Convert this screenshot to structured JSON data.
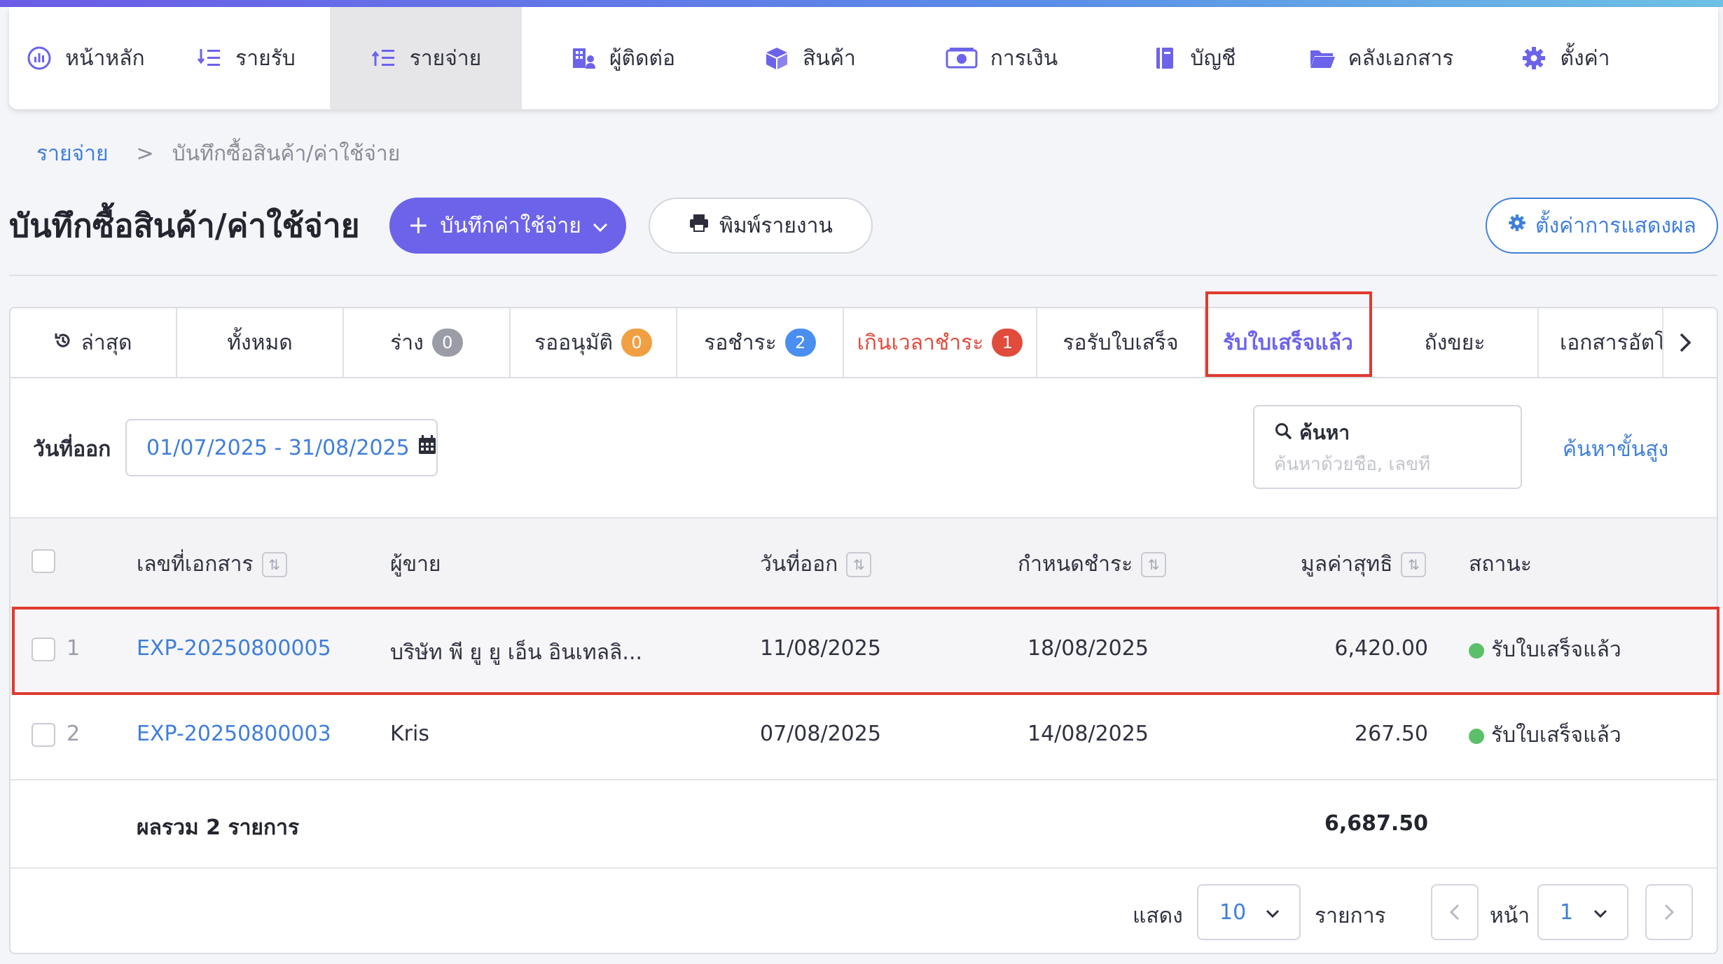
{
  "nav": {
    "items": [
      {
        "label": "หน้าหลัก",
        "icon": "dashboard-icon"
      },
      {
        "label": "รายรับ",
        "icon": "income-list-icon"
      },
      {
        "label": "รายจ่าย",
        "icon": "expense-list-icon",
        "active": true
      },
      {
        "label": "ผู้ติดต่อ",
        "icon": "contacts-building-icon"
      },
      {
        "label": "สินค้า",
        "icon": "product-box-icon"
      },
      {
        "label": "การเงิน",
        "icon": "money-icon"
      },
      {
        "label": "บัญชี",
        "icon": "ledger-book-icon"
      },
      {
        "label": "คลังเอกสาร",
        "icon": "folder-icon"
      },
      {
        "label": "ตั้งค่า",
        "icon": "gear-icon"
      }
    ]
  },
  "breadcrumb": {
    "parent": "รายจ่าย",
    "separator": ">",
    "current": "บันทึกซื้อสินค้า/ค่าใช้จ่าย"
  },
  "page": {
    "title": "บันทึกซื้อสินค้า/ค่าใช้จ่าย",
    "add_button": "บันทึกค่าใช้จ่าย",
    "print_button": "พิมพ์รายงาน",
    "settings_button": "ตั้งค่าการแสดงผล"
  },
  "tabs": [
    {
      "label": "ล่าสุด",
      "icon": "history-icon"
    },
    {
      "label": "ทั้งหมด"
    },
    {
      "label": "ร่าง",
      "badge": "0",
      "badge_color": "#9a9ca6"
    },
    {
      "label": "รออนุมัติ",
      "badge": "0",
      "badge_color": "#f0a042"
    },
    {
      "label": "รอชำระ",
      "badge": "2",
      "badge_color": "#4a8ff0"
    },
    {
      "label": "เกินเวลาชำระ",
      "badge": "1",
      "badge_color": "#e04b3c"
    },
    {
      "label": "รอรับใบเสร็จ"
    },
    {
      "label": "รับใบเสร็จแล้ว",
      "selected": true
    },
    {
      "label": "ถังขยะ"
    },
    {
      "label": "เอกสารอัตโน"
    }
  ],
  "filters": {
    "date_label": "วันที่ออก",
    "date_range": "01/07/2025 - 31/08/2025",
    "search_label": "ค้นหา",
    "search_placeholder": "ค้นหาด้วยชื่อ, เลขที่",
    "advanced_search": "ค้นหาขั้นสูง"
  },
  "table": {
    "headers": {
      "doc_no": "เลขที่เอกสาร",
      "vendor": "ผู้ขาย",
      "issue_date": "วันที่ออก",
      "due_date": "กำหนดชำระ",
      "net_amount": "มูลค่าสุทธิ",
      "status": "สถานะ"
    },
    "rows": [
      {
        "num": "1",
        "doc_no": "EXP-20250800005",
        "vendor": "บริษัท พี ยู ยู เอ็น อินเทลลิ...",
        "issue_date": "11/08/2025",
        "due_date": "18/08/2025",
        "net_amount": "6,420.00",
        "status": "รับใบเสร็จแล้ว"
      },
      {
        "num": "2",
        "doc_no": "EXP-20250800003",
        "vendor": "Kris",
        "issue_date": "07/08/2025",
        "due_date": "14/08/2025",
        "net_amount": "267.50",
        "status": "รับใบเสร็จแล้ว"
      }
    ],
    "total_label": "ผลรวม 2 รายการ",
    "total_amount": "6,687.50"
  },
  "pagination": {
    "show_label": "แสดง",
    "page_size": "10",
    "items_label": "รายการ",
    "page_label": "หน้า",
    "page": "1"
  },
  "colors": {
    "accent": "#6c63ea",
    "link": "#3f7fd9",
    "status_ok": "#5cc06a",
    "highlight": "#e03a2f"
  }
}
